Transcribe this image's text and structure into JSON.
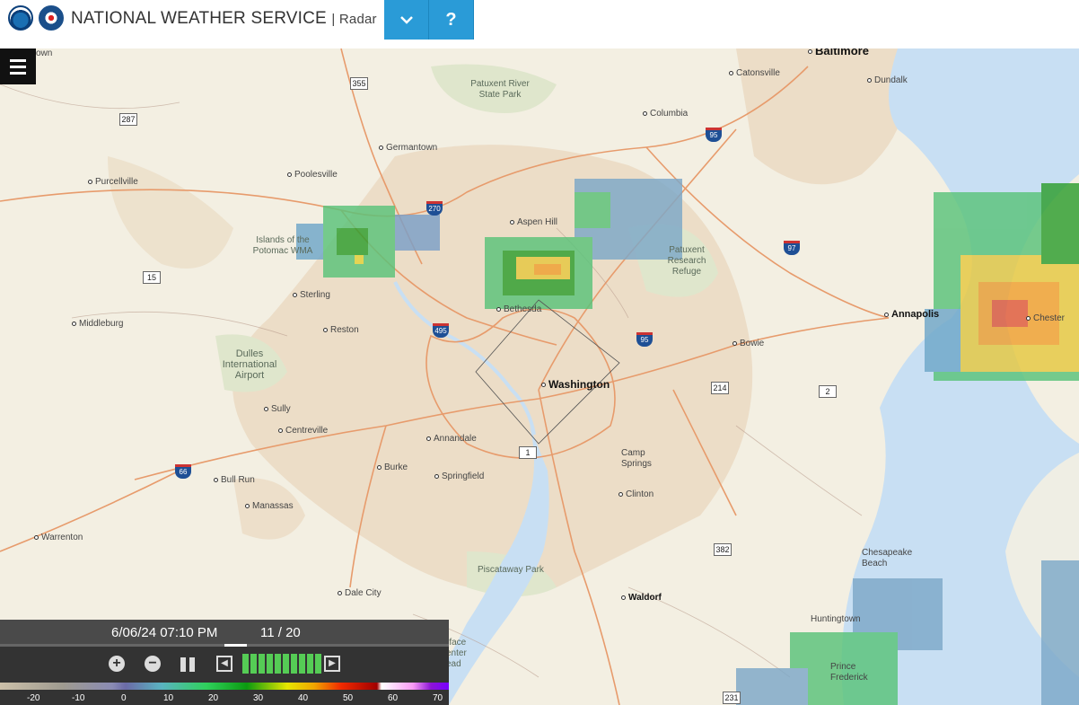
{
  "header": {
    "title": "NATIONAL WEATHER SERVICE",
    "subtitle": "| Radar",
    "dropdown_icon": "chevron-down-icon",
    "help_label": "?"
  },
  "map": {
    "places": [
      {
        "name": "Baltimore",
        "type": "city"
      },
      {
        "name": "Catonsville"
      },
      {
        "name": "Dundalk"
      },
      {
        "name": "Columbia"
      },
      {
        "name": "Germantown"
      },
      {
        "name": "Poolesville"
      },
      {
        "name": "Purcellville"
      },
      {
        "name": "Aspen Hill"
      },
      {
        "name": "Bethesda"
      },
      {
        "name": "Sterling"
      },
      {
        "name": "Reston"
      },
      {
        "name": "Middleburg"
      },
      {
        "name": "Washington",
        "type": "city"
      },
      {
        "name": "Annapolis",
        "type": "city"
      },
      {
        "name": "Chester"
      },
      {
        "name": "Bowie"
      },
      {
        "name": "Sully"
      },
      {
        "name": "Centreville"
      },
      {
        "name": "Annandale"
      },
      {
        "name": "Burke"
      },
      {
        "name": "Springfield"
      },
      {
        "name": "Bull Run"
      },
      {
        "name": "Manassas"
      },
      {
        "name": "Warrenton"
      },
      {
        "name": "Dale City"
      },
      {
        "name": "Clinton"
      },
      {
        "name": "Camp Springs"
      },
      {
        "name": "Waldorf"
      },
      {
        "name": "Chesapeake Beach"
      },
      {
        "name": "Huntingtown"
      },
      {
        "name": "Prince Frederick"
      },
      {
        "name": "own"
      }
    ],
    "parks": [
      {
        "name": "Patuxent River State Park"
      },
      {
        "name": "Islands of the Potomac WMA"
      },
      {
        "name": "Dulles International Airport"
      },
      {
        "name": "Patuxent Research Refuge"
      },
      {
        "name": "Piscataway Park"
      },
      {
        "name": "rface enter ead"
      }
    ],
    "routes": [
      "355",
      "287",
      "15",
      "270",
      "495",
      "95",
      "97",
      "214",
      "2",
      "66",
      "1",
      "382",
      "231"
    ]
  },
  "controls": {
    "timestamp": "6/06/24 07:10 PM",
    "frame": "11 / 20",
    "frame_position": 0.55,
    "zoom_in": "+",
    "zoom_out": "−",
    "scale_labels": [
      "-20",
      "-10",
      "0",
      "10",
      "20",
      "30",
      "40",
      "50",
      "60",
      "70"
    ]
  },
  "colors": {
    "header_button": "#2a9bd7",
    "control_panel": "#333333"
  }
}
